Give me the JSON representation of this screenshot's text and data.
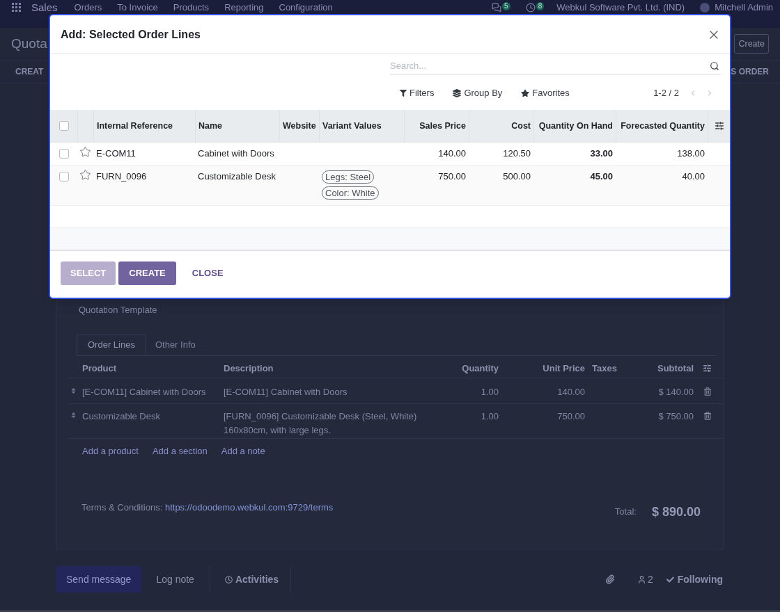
{
  "navbar": {
    "app_name": "Sales",
    "menu": [
      "Orders",
      "To Invoice",
      "Products",
      "Reporting",
      "Configuration"
    ],
    "messages_count": "5",
    "activities_count": "8",
    "company": "Webkul Software Pvt. Ltd. (IND)",
    "user": "Mitchell Admin"
  },
  "control_panel": {
    "title": "Quota",
    "create_button": "Create",
    "left_action": "CREAT",
    "right_action": "S ORDER"
  },
  "form": {
    "template_label": "Quotation Template",
    "tabs": [
      {
        "label": "Order Lines",
        "selected": true
      },
      {
        "label": "Other Info",
        "selected": false
      }
    ],
    "order_lines": {
      "columns": [
        "Product",
        "Description",
        "Quantity",
        "Unit Price",
        "Taxes",
        "Subtotal"
      ],
      "rows": [
        {
          "product": "[E-COM11] Cabinet with Doors",
          "description": "[E-COM11] Cabinet with Doors",
          "quantity": "1.00",
          "unit_price": "140.00",
          "subtotal": "$ 140.00"
        },
        {
          "product": "Customizable Desk",
          "description": "[FURN_0096] Customizable Desk (Steel, White)\n160x80cm, with large legs.",
          "quantity": "1.00",
          "unit_price": "750.00",
          "subtotal": "$ 750.00"
        }
      ],
      "add_links": [
        "Add a product",
        "Add a section",
        "Add a note"
      ]
    },
    "terms_label": "Terms & Conditions:",
    "terms_link": "https://odoodemo.webkul.com:9729/terms",
    "total_label": "Total:",
    "total": "$ 890.00"
  },
  "chatter": {
    "buttons": [
      {
        "label": "Send message",
        "kind": "primary"
      },
      {
        "label": "Log note",
        "kind": "plain"
      },
      {
        "label": "Activities",
        "kind": "activity"
      }
    ],
    "followers_count": "2",
    "follow_status": "Following"
  },
  "dialog": {
    "title": "Add: Selected Order Lines",
    "search": {
      "placeholder": "Search..."
    },
    "search_options": [
      {
        "label": "Filters",
        "kind": "filter"
      },
      {
        "label": "Group By",
        "kind": "group"
      },
      {
        "label": "Favorites",
        "kind": "favorite"
      }
    ],
    "pager": {
      "range": "1-2 / 2",
      "disabled": true
    },
    "list": {
      "all_selected": false,
      "columns": [
        {
          "label": "Internal Reference",
          "kind": "text"
        },
        {
          "label": "Name",
          "kind": "text"
        },
        {
          "label": "Website",
          "kind": "text"
        },
        {
          "label": "Variant Values",
          "kind": "tags"
        },
        {
          "label": "Sales Price",
          "kind": "number"
        },
        {
          "label": "Cost",
          "kind": "number"
        },
        {
          "label": "Quantity On Hand",
          "kind": "stock"
        },
        {
          "label": "Forecasted Quantity",
          "kind": "number"
        }
      ],
      "rows": [
        {
          "selected": false,
          "favorite": false,
          "internal_reference": "E-COM11",
          "name": "Cabinet with Doors",
          "sales_price": "140.00",
          "cost": "120.50",
          "quantity_on_hand": "33.00",
          "forecasted_quantity": "138.00"
        },
        {
          "selected": false,
          "favorite": false,
          "internal_reference": "FURN_0096",
          "name": "Customizable Desk",
          "variant_values": [
            "Legs: Steel",
            "Color: White"
          ],
          "sales_price": "750.00",
          "cost": "500.00",
          "quantity_on_hand": "45.00",
          "forecasted_quantity": "40.00"
        }
      ]
    },
    "buttons": [
      {
        "label": "SELECT",
        "kind": "primary",
        "disabled": true
      },
      {
        "label": "CREATE",
        "kind": "primary",
        "disabled": false
      },
      {
        "label": "CLOSE",
        "kind": "link",
        "disabled": false
      }
    ]
  }
}
